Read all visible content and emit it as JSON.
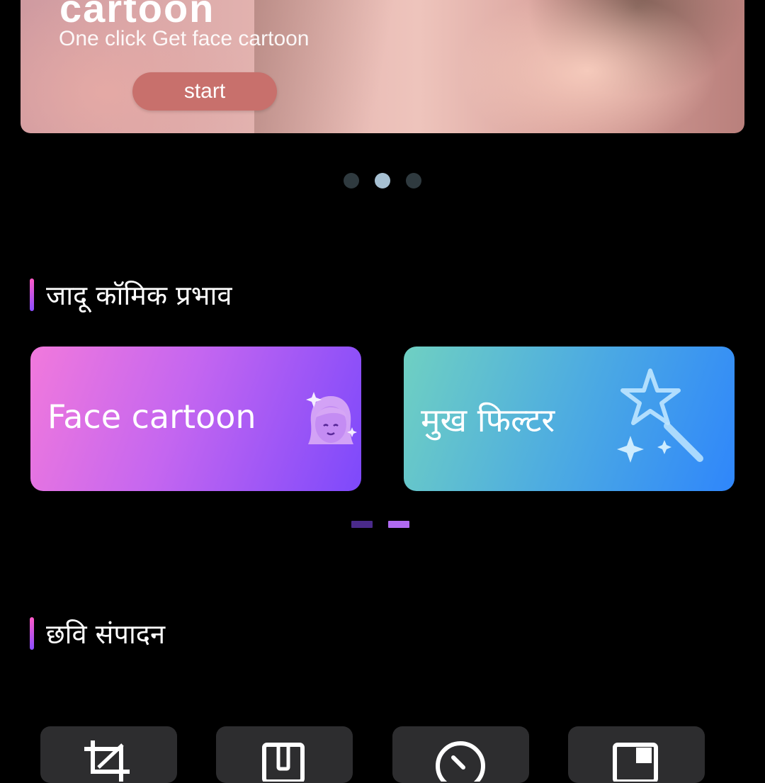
{
  "banner": {
    "title": "cartoon",
    "subtitle": "One click Get face cartoon",
    "button_label": "start",
    "carousel": {
      "count": 3,
      "active_index": 1
    }
  },
  "magic_section": {
    "title": "जादू कॉमिक प्रभाव",
    "cards": [
      {
        "label": "Face cartoon",
        "icon": "cartoon-face-icon"
      },
      {
        "label": "मुख फिल्टर",
        "icon": "magic-wand-icon"
      }
    ],
    "pager": {
      "count": 2,
      "active_index": 1
    }
  },
  "edit_section": {
    "title": "छवि संपादन",
    "tools": [
      {
        "icon": "crop-icon"
      },
      {
        "icon": "rotate-icon"
      },
      {
        "icon": "adjust-icon"
      },
      {
        "icon": "frame-icon"
      }
    ]
  },
  "colors": {
    "background": "#000000",
    "start_button": "#c8706c",
    "section_accent_top": "#ff5bc8",
    "section_accent_bottom": "#8a4dff",
    "tool_tile": "#2d2d2f"
  }
}
